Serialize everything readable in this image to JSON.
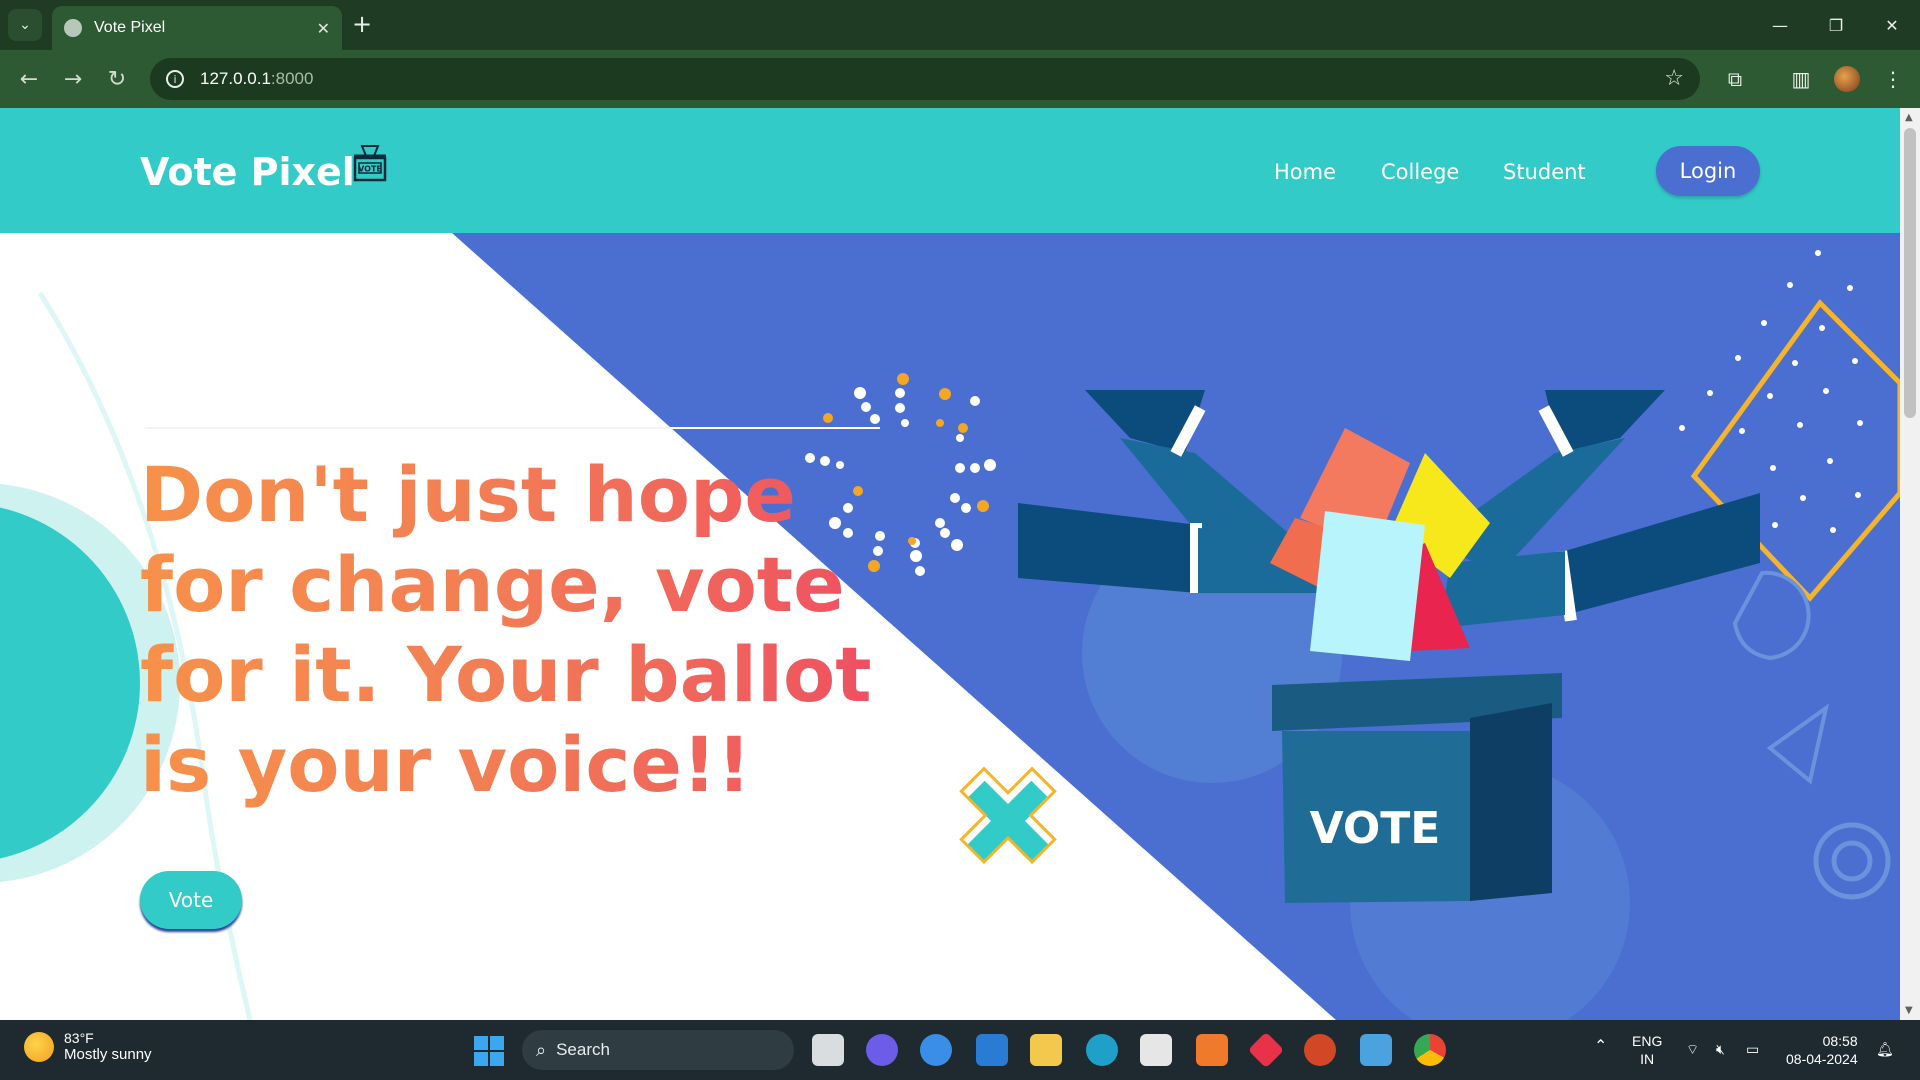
{
  "browser": {
    "tab_title": "Vote Pixel",
    "new_tab": "+",
    "close_tab": "✕",
    "url_host": "127.0.0.1",
    "url_port": ":8000",
    "window_controls": [
      "—",
      "❐",
      "✕"
    ]
  },
  "site": {
    "brand": "Vote Pixel",
    "brand_icon_text": "VOTE",
    "nav": [
      "Home",
      "College",
      "Student"
    ],
    "login_label": "Login",
    "headline": "Don't just hope for change, vote for it. Your ballot is your voice!!",
    "vote_button": "Vote",
    "ballot_box_label": "VOTE",
    "colors": {
      "header": "#33cbc8",
      "hero_blue": "#4b6fd1",
      "headline_orange": "#f7914a",
      "headline_pink": "#ee4d63"
    }
  },
  "taskbar": {
    "weather_temp": "83°F",
    "weather_desc": "Mostly sunny",
    "search_label": "Search",
    "lang_1": "ENG",
    "lang_2": "IN",
    "time": "08:58",
    "date": "08-04-2024"
  }
}
